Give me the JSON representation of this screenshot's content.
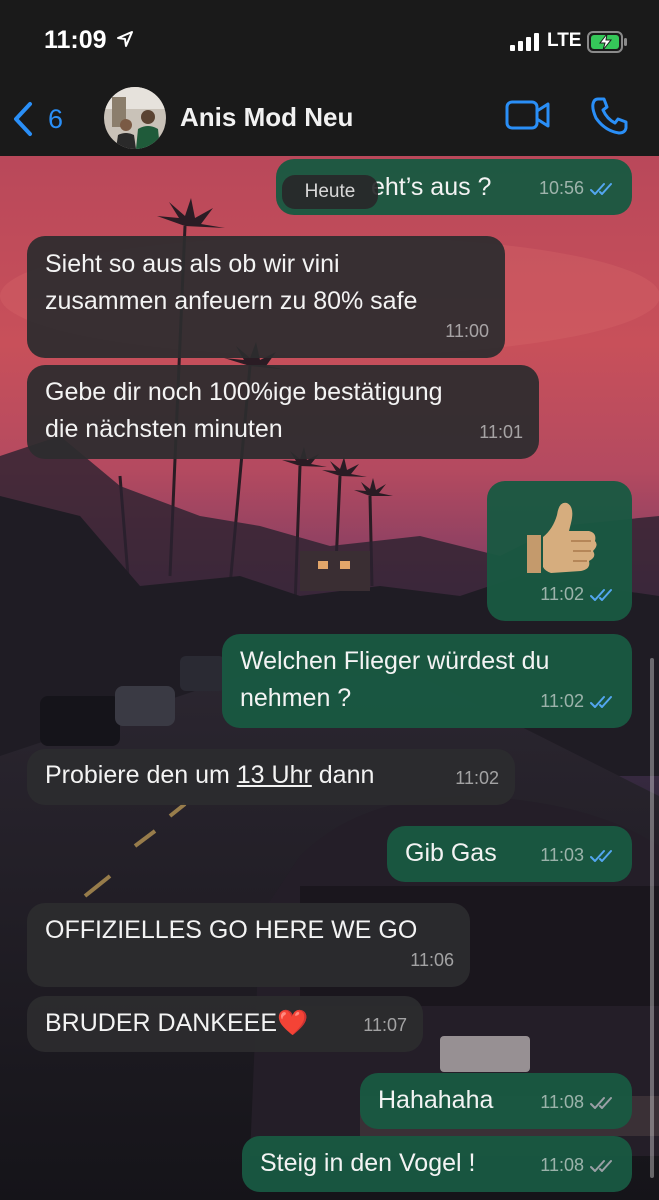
{
  "status_bar": {
    "time": "11:09",
    "network": "LTE"
  },
  "header": {
    "back_count": "6",
    "contact_name": "Anis Mod Neu"
  },
  "chat": {
    "day_label": "Heute",
    "messages": [
      {
        "dir": "out",
        "text": "Wie sieht’s aus ?",
        "visible_text": "eht’s aus ?",
        "time": "10:56",
        "status": "read"
      },
      {
        "dir": "in",
        "lines": [
          "Sieht so aus als ob wir vini",
          "zusammen anfeuern zu 80% safe"
        ],
        "time": "11:00"
      },
      {
        "dir": "in",
        "lines": [
          "Gebe dir noch 100%ige bestätigung",
          "die nächsten minuten"
        ],
        "time": "11:01"
      },
      {
        "dir": "out",
        "emoji": "thumbs-up",
        "time": "11:02",
        "status": "read"
      },
      {
        "dir": "out",
        "lines": [
          "Welchen Flieger würdest du",
          "nehmen ?"
        ],
        "time": "11:02",
        "status": "read"
      },
      {
        "dir": "in",
        "text_before": "Probiere den um ",
        "link_text": "13 Uhr",
        "text_after": " dann",
        "time": "11:02"
      },
      {
        "dir": "out",
        "text": "Gib Gas",
        "time": "11:03",
        "status": "read"
      },
      {
        "dir": "in",
        "text": "OFFIZIELLES GO HERE WE GO",
        "time": "11:06"
      },
      {
        "dir": "in",
        "text": "BRUDER DANKEEE",
        "emoji": "❤️",
        "time": "11:07"
      },
      {
        "dir": "out",
        "text": "Hahahaha",
        "time": "11:08",
        "status": "delivered"
      },
      {
        "dir": "out",
        "text": "Steig in den Vogel !",
        "time": "11:08",
        "status": "delivered"
      }
    ]
  },
  "colors": {
    "accent": "#2a8ff7",
    "read_tick": "#53a6f0",
    "delivered_tick": "#9aa0a6",
    "bubble_incoming": "#2c2c2e",
    "bubble_outgoing": "#195842"
  }
}
